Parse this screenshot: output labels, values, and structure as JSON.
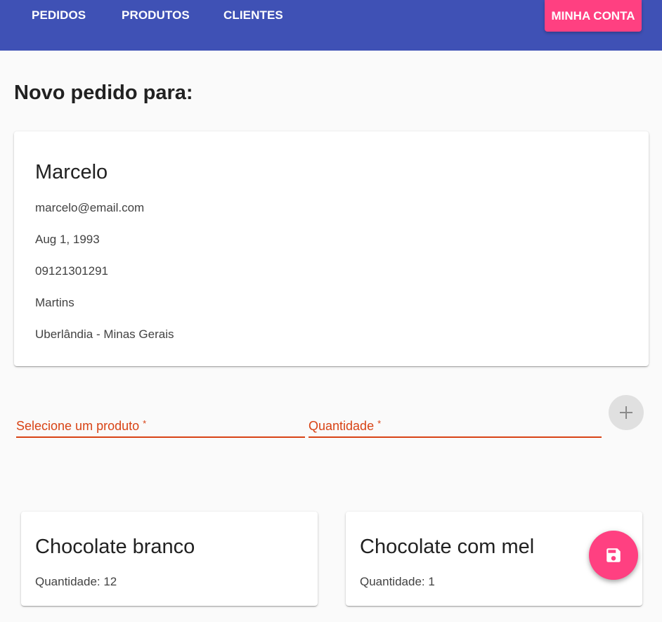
{
  "nav": {
    "links": [
      "PEDIDOS",
      "PRODUTOS",
      "CLIENTES"
    ],
    "account_label": "MINHA CONTA"
  },
  "page": {
    "title": "Novo pedido para:"
  },
  "client": {
    "name": "Marcelo",
    "email": "marcelo@email.com",
    "birth_date": "Aug 1, 1993",
    "phone": "09121301291",
    "neighborhood": "Martins",
    "city_state": "Uberlândia - Minas Gerais"
  },
  "form": {
    "product_label": "Selecione um produto",
    "quantity_label": "Quantidade",
    "required_mark": "*"
  },
  "items": [
    {
      "name": "Chocolate branco",
      "quantity": "Quantidade: 12"
    },
    {
      "name": "Chocolate com mel",
      "quantity": "Quantidade: 1"
    }
  ],
  "icons": {
    "add": "plus-icon",
    "save": "floppy-disk-icon"
  },
  "colors": {
    "primary": "#3f51b5",
    "accent": "#ff4081",
    "error": "#d84315"
  }
}
